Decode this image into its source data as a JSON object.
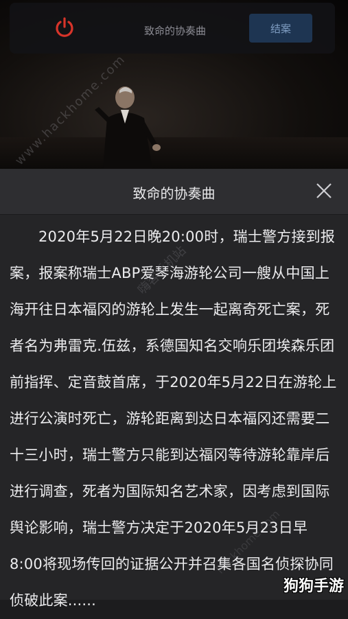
{
  "header": {
    "title": "致命的协奏曲",
    "close_case_label": "结案",
    "power_icon": "power-icon"
  },
  "watermark": {
    "site": "www.hackhome.com",
    "app": "嗨客手机站",
    "site_bottom": "hackhome.com"
  },
  "dialog": {
    "title": "致命的协奏曲",
    "close_icon": "close-icon",
    "body": "2020年5月22日晚20:00时，瑞士警方接到报案，报案称瑞士ABP爱琴海游轮公司一艘从中国上海开往日本福冈的游轮上发生一起离奇死亡案，死者名为弗雷克.伍兹，系德国知名交响乐团埃森乐团前指挥、定音鼓首席，于2020年5月22日在游轮上进行公演时死亡，游轮距离到达日本福冈还需要二十三小时，瑞士警方只能到达福冈等待游轮靠岸后进行调查，死者为国际知名艺术家，因考虑到国际舆论影响，瑞士警方决定于2020年5月23日早8:00将现场传回的证据公开并召集各国名侦探协同侦破此案......"
  },
  "brand": {
    "logo_text": "狗狗手游"
  },
  "colors": {
    "accent_red": "#d7342a",
    "button_bg": "#1e3552",
    "dialog_bg": "#252527"
  }
}
